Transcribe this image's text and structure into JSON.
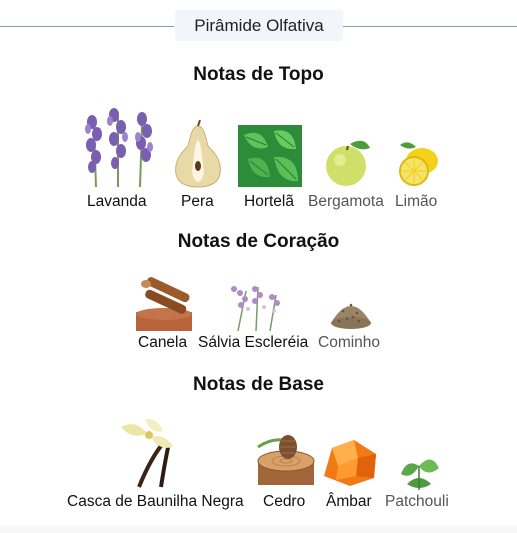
{
  "header": {
    "title": "Pirâmide Olfativa"
  },
  "sections": {
    "top": {
      "title": "Notas de Topo",
      "notes": [
        "Lavanda",
        "Pera",
        "Hortelã",
        "Bergamota",
        "Limão"
      ]
    },
    "heart": {
      "title": "Notas de Coração",
      "notes": [
        "Canela",
        "Sálvia Escleréia",
        "Cominho"
      ]
    },
    "base": {
      "title": "Notas de Base",
      "notes": [
        "Casca de Baunilha Negra",
        "Cedro",
        "Âmbar",
        "Patchouli"
      ]
    }
  },
  "icons": {
    "lavanda": "lavender-image",
    "pera": "pear-image",
    "hortela": "mint-image",
    "bergamota": "bergamot-image",
    "limao": "lemon-image",
    "canela": "cinnamon-image",
    "salvia": "clary-sage-image",
    "cominho": "cumin-image",
    "baunilha": "vanilla-image",
    "cedro": "cedar-image",
    "ambar": "amber-image",
    "patchouli": "patchouli-image"
  }
}
